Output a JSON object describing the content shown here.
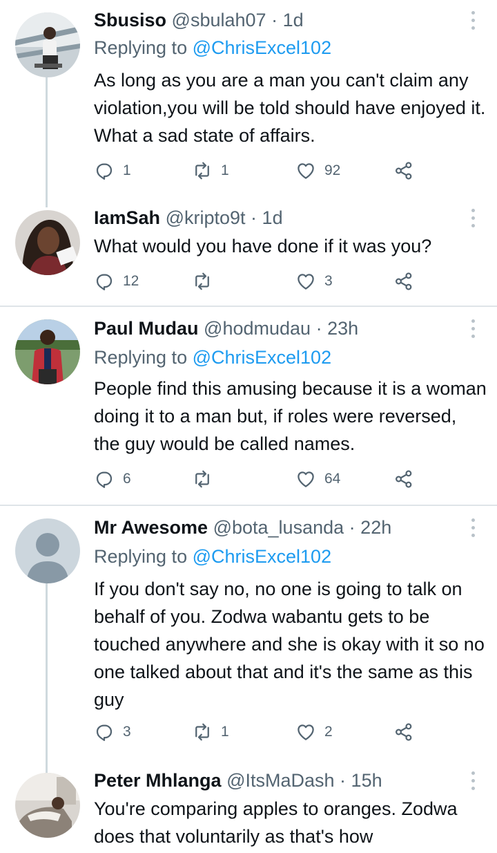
{
  "tweets": [
    {
      "name": "Sbusiso",
      "handle": "@sbulah07",
      "separator": "·",
      "time": "1d",
      "replying_prefix": "Replying to ",
      "replying_to": "@ChrisExcel102",
      "text": "As long as you are a man you can't claim any violation,you will be told should have enjoyed it. What a sad state of affairs.",
      "replies": "1",
      "retweets": "1",
      "likes": "92"
    },
    {
      "name": "IamSah",
      "handle": "@kripto9t",
      "separator": "·",
      "time": "1d",
      "text": "What would you have done if it was you?",
      "replies": "12",
      "retweets": "",
      "likes": "3"
    },
    {
      "name": "Paul Mudau",
      "handle": "@hodmudau",
      "separator": "·",
      "time": "23h",
      "replying_prefix": "Replying to ",
      "replying_to": "@ChrisExcel102",
      "text": "People find this amusing because it is a woman doing it to a man but, if roles were reversed, the guy would be called names.",
      "replies": "6",
      "retweets": "",
      "likes": "64"
    },
    {
      "name": "Mr Awesome",
      "handle": "@bota_lusanda",
      "separator": "·",
      "time": "22h",
      "replying_prefix": "Replying to ",
      "replying_to": "@ChrisExcel102",
      "text": "If you don't say no, no one is going to talk on behalf of you. Zodwa wabantu gets to be touched anywhere and she is okay with it so no one talked about that and it's the same as this guy",
      "replies": "3",
      "retweets": "1",
      "likes": "2"
    },
    {
      "name": "Peter Mhlanga",
      "handle": "@ItsMaDash",
      "separator": "·",
      "time": "15h",
      "text": "You're comparing apples to oranges. Zodwa does that voluntarily as that's how"
    }
  ],
  "icons": {
    "reply": "reply-icon",
    "retweet": "retweet-icon",
    "like": "heart-icon",
    "share": "share-icon",
    "more": "more-options-icon"
  },
  "colors": {
    "mention": "#1d9bf0",
    "secondary_text": "#536471",
    "divider": "#dfe4e8",
    "thread_line": "#cfd9de"
  }
}
